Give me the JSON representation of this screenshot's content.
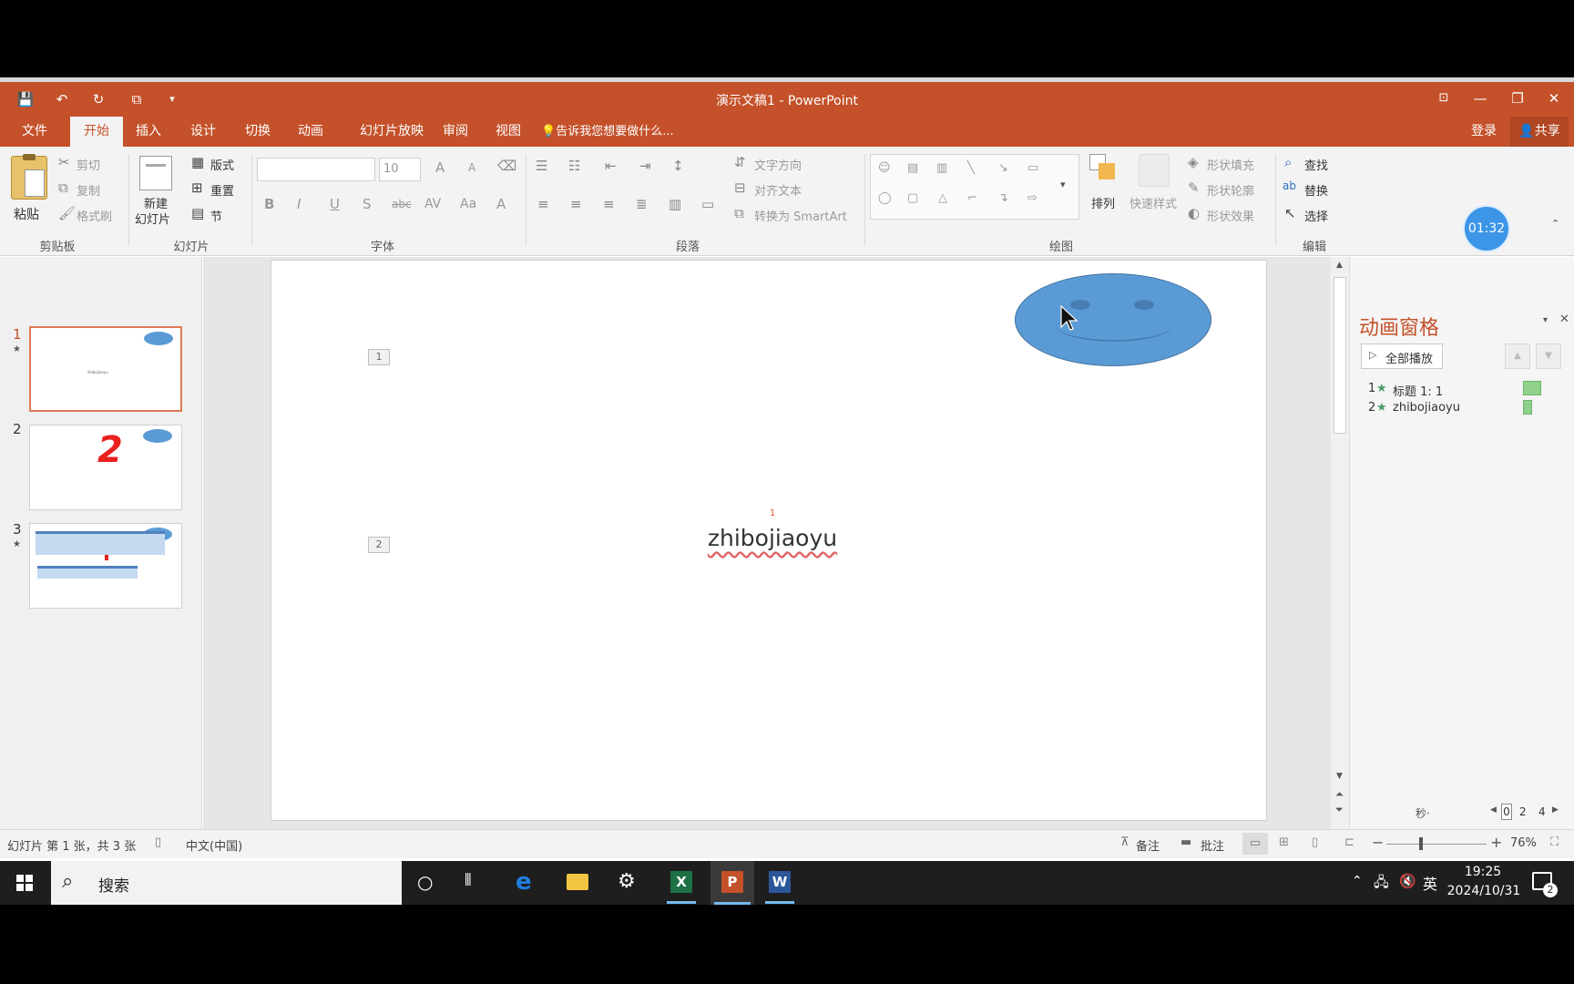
{
  "qat": {
    "save": "💾",
    "undo": "↶",
    "redo": "↻",
    "present": "⧉",
    "customize": "▾"
  },
  "window": {
    "title": "演示文稿1 - PowerPoint",
    "ribbon_display": "⊡",
    "minimize": "—",
    "restore": "❐",
    "close": "✕"
  },
  "tabs": [
    "文件",
    "开始",
    "插入",
    "设计",
    "切换",
    "动画",
    "幻灯片放映",
    "审阅",
    "视图"
  ],
  "tell_me": "告诉我您想要做什么...",
  "signin": "登录",
  "share": "共享",
  "clipboard": {
    "paste": "粘贴",
    "cut": "剪切",
    "copy": "复制",
    "format_painter": "格式刷",
    "group": "剪贴板"
  },
  "slides_group": {
    "new_slide_line1": "新建",
    "new_slide_line2": "幻灯片",
    "layout": "版式",
    "reset": "重置",
    "section": "节",
    "group": "幻灯片"
  },
  "font_group": {
    "font_name": "",
    "font_size": "10",
    "group": "字体",
    "bold": "B",
    "italic": "I",
    "underline": "U",
    "shadow": "S",
    "strike": "abc",
    "spacing": "AV",
    "case": "Aa",
    "color": "A",
    "grow": "A",
    "shrink": "A"
  },
  "paragraph_group": {
    "text_direction": "文字方向",
    "align_text": "对齐文本",
    "convert_smartart": "转换为 SmartArt",
    "group": "段落"
  },
  "drawing_group": {
    "arrange": "排列",
    "quick_styles": "快速样式",
    "shape_fill": "形状填充",
    "shape_outline": "形状轮廓",
    "shape_effects": "形状效果",
    "group": "绘图"
  },
  "editing_group": {
    "find": "查找",
    "replace": "替换",
    "select": "选择",
    "group": "编辑"
  },
  "timer": "01:32",
  "thumbnails": [
    {
      "num": "1",
      "star": "★",
      "text": "zhibojiaoyu"
    },
    {
      "num": "2",
      "glyph": "2"
    },
    {
      "num": "3",
      "star": "★"
    }
  ],
  "slide": {
    "anim_tag1": "1",
    "anim_tag2": "2",
    "small_marker": "1",
    "text": "zhibojiaoyu"
  },
  "anim_pane": {
    "title": "动画窗格",
    "play_all": "全部播放",
    "items": [
      {
        "num": "1",
        "label": "标题 1: 1"
      },
      {
        "num": "2",
        "label": "zhibojiaoyu"
      }
    ],
    "seconds": "秒·",
    "timeline": [
      "0",
      "2",
      "4"
    ]
  },
  "status": {
    "slide_info": "幻灯片 第 1 张，共 3 张",
    "language": "中文(中国)",
    "notes": "备注",
    "comments": "批注",
    "zoom": "76%"
  },
  "taskbar": {
    "search": "搜索",
    "time": "19:25",
    "date": "2024/10/31",
    "ime": "英",
    "notif_count": "2"
  },
  "colors": {
    "accent": "#c4512a",
    "shape_blue": "#5b9bd5",
    "anim_green": "#8fd18b"
  }
}
